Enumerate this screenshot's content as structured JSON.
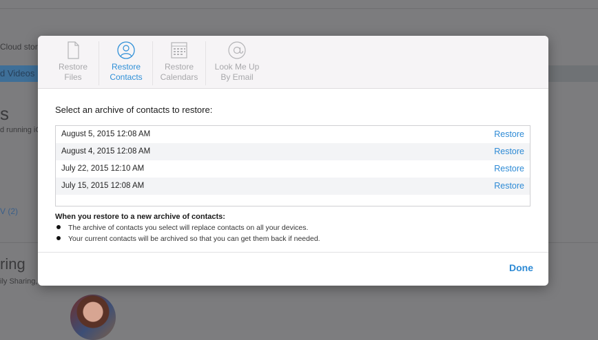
{
  "background": {
    "cloud_storage_fragment": "Cloud stora",
    "videos_tab": "d Videos",
    "heading_fragment": "s",
    "running_fragment": "d running iC",
    "link_fragment": "V (2)",
    "sharing_heading_fragment": "ring",
    "family_sharing_fragment": "ily Sharing,"
  },
  "toolbar": {
    "items": [
      {
        "label_line1": "Restore",
        "label_line2": "Files",
        "icon": "file-icon",
        "active": false
      },
      {
        "label_line1": "Restore",
        "label_line2": "Contacts",
        "icon": "contacts-icon",
        "active": true
      },
      {
        "label_line1": "Restore",
        "label_line2": "Calendars",
        "icon": "calendar-icon",
        "active": false
      },
      {
        "label_line1": "Look Me Up",
        "label_line2": "By Email",
        "icon": "at-sign-icon",
        "active": false
      }
    ]
  },
  "prompt": "Select an archive of contacts to restore:",
  "archives": [
    {
      "date": "August 5, 2015 12:08 AM",
      "action": "Restore"
    },
    {
      "date": "August 4, 2015 12:08 AM",
      "action": "Restore"
    },
    {
      "date": "July 22, 2015 12:10 AM",
      "action": "Restore"
    },
    {
      "date": "July 15, 2015 12:08 AM",
      "action": "Restore"
    }
  ],
  "note": {
    "title": "When you restore to a new archive of contacts:",
    "bullets": [
      "The archive of contacts you select will replace contacts on all your devices.",
      "Your current contacts will be archived so that you can get them back if needed."
    ]
  },
  "footer": {
    "done_label": "Done"
  },
  "colors": {
    "accent": "#2d8ad5",
    "inactive_tool": "#a8a8ab"
  }
}
